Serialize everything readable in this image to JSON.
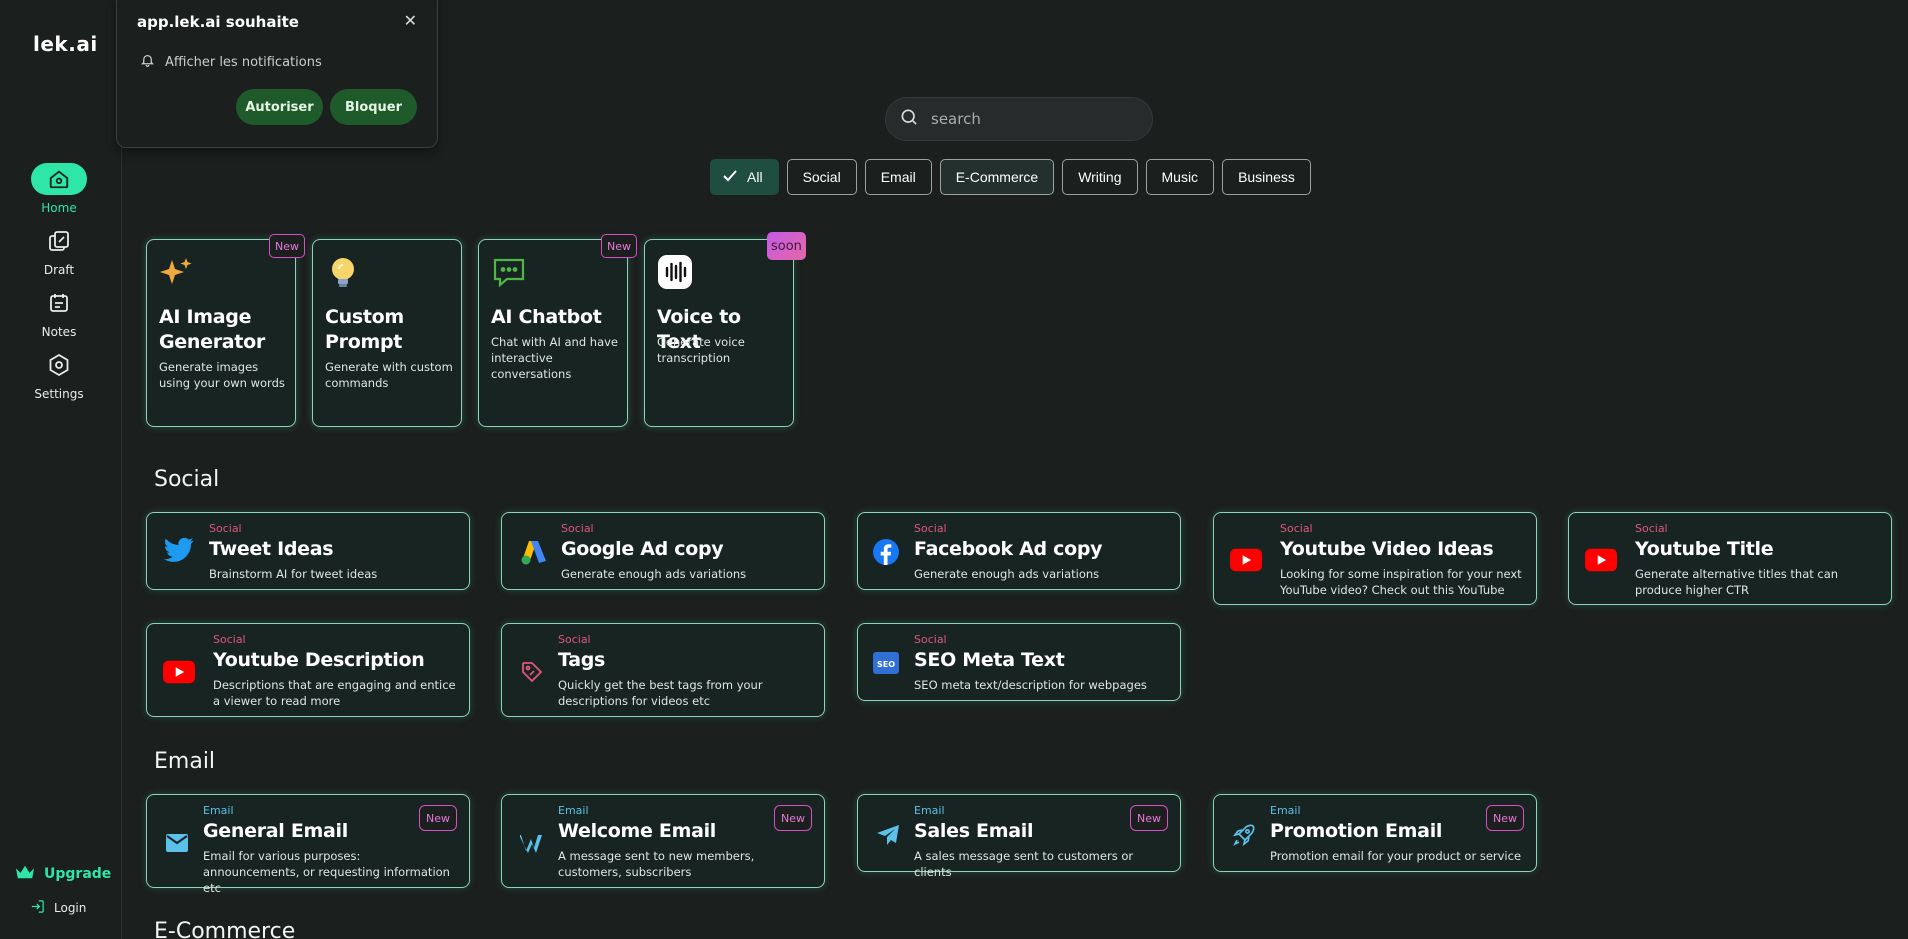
{
  "sidebar": {
    "logo": "lek.ai",
    "items": [
      {
        "label": "Home"
      },
      {
        "label": "Draft"
      },
      {
        "label": "Notes"
      },
      {
        "label": "Settings"
      }
    ],
    "upgrade_label": "Upgrade",
    "login_label": "Login"
  },
  "notification": {
    "title": "app.lek.ai souhaite",
    "message": "Afficher les notifications",
    "allow_label": "Autoriser",
    "block_label": "Bloquer"
  },
  "search": {
    "placeholder": "search"
  },
  "filters": [
    "All",
    "Social",
    "Email",
    "E-Commerce",
    "Writing",
    "Music",
    "Business"
  ],
  "feature_cards": [
    {
      "title": "AI Image Generator",
      "desc": "Generate images using your own words",
      "badge": "New"
    },
    {
      "title": "Custom Prompt",
      "desc": "Generate with custom commands",
      "badge": ""
    },
    {
      "title": "AI Chatbot",
      "desc": "Chat with AI and have interactive conversations",
      "badge": "New"
    },
    {
      "title": "Voice to Text",
      "desc": "Generate voice transcription",
      "badge": "soon"
    }
  ],
  "sections": {
    "social": {
      "title": "Social",
      "cards": [
        {
          "category": "Social",
          "title": "Tweet Ideas",
          "desc": "Brainstorm AI for tweet ideas"
        },
        {
          "category": "Social",
          "title": "Google Ad copy",
          "desc": "Generate enough ads variations"
        },
        {
          "category": "Social",
          "title": "Facebook Ad copy",
          "desc": "Generate enough ads variations"
        },
        {
          "category": "Social",
          "title": "Youtube Video Ideas",
          "desc": "Looking for some inspiration for your next YouTube video? Check out this YouTube Vi..."
        },
        {
          "category": "Social",
          "title": "Youtube Title",
          "desc": "Generate alternative titles that can produce higher CTR"
        },
        {
          "category": "Social",
          "title": "Youtube Description",
          "desc": "Descriptions that are engaging and entice a viewer to read more"
        },
        {
          "category": "Social",
          "title": "Tags",
          "desc": "Quickly get the best tags from your descriptions for videos etc"
        },
        {
          "category": "Social",
          "title": "SEO Meta Text",
          "desc": "SEO meta text/description for webpages"
        }
      ]
    },
    "email": {
      "title": "Email",
      "cards": [
        {
          "category": "Email",
          "title": "General Email",
          "desc": "Email for various purposes: announcements, or requesting information etc",
          "badge": "New"
        },
        {
          "category": "Email",
          "title": "Welcome Email",
          "desc": "A message sent to new members, customers, subscribers",
          "badge": "New"
        },
        {
          "category": "Email",
          "title": "Sales Email",
          "desc": "A sales message sent to customers or clients",
          "badge": "New"
        },
        {
          "category": "Email",
          "title": "Promotion Email",
          "desc": "Promotion email for your product or service",
          "badge": "New"
        }
      ]
    },
    "ecommerce": {
      "title": "E-Commerce"
    }
  },
  "colors": {
    "accent": "#2ee6a8",
    "card_border": "#88d5b9",
    "social_category": "#e2557d",
    "email_category": "#5bc0ea",
    "new_badge": "#d84ec4"
  }
}
